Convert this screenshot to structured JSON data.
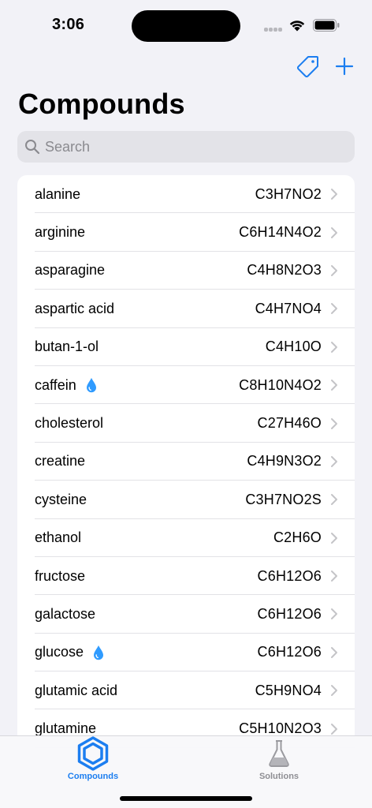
{
  "status": {
    "time": "3:06"
  },
  "nav": {
    "tag_icon": "tag-icon",
    "add_icon": "plus-icon"
  },
  "title": "Compounds",
  "search": {
    "placeholder": "Search",
    "value": ""
  },
  "compounds": [
    {
      "name": "alanine",
      "formula": "C3H7NO2",
      "liquid": false
    },
    {
      "name": "arginine",
      "formula": "C6H14N4O2",
      "liquid": false
    },
    {
      "name": "asparagine",
      "formula": "C4H8N2O3",
      "liquid": false
    },
    {
      "name": "aspartic acid",
      "formula": "C4H7NO4",
      "liquid": false
    },
    {
      "name": "butan-1-ol",
      "formula": "C4H10O",
      "liquid": false
    },
    {
      "name": "caffein",
      "formula": "C8H10N4O2",
      "liquid": true
    },
    {
      "name": "cholesterol",
      "formula": "C27H46O",
      "liquid": false
    },
    {
      "name": "creatine",
      "formula": "C4H9N3O2",
      "liquid": false
    },
    {
      "name": "cysteine",
      "formula": "C3H7NO2S",
      "liquid": false
    },
    {
      "name": "ethanol",
      "formula": "C2H6O",
      "liquid": false
    },
    {
      "name": "fructose",
      "formula": "C6H12O6",
      "liquid": false
    },
    {
      "name": "galactose",
      "formula": "C6H12O6",
      "liquid": false
    },
    {
      "name": "glucose",
      "formula": "C6H12O6",
      "liquid": true
    },
    {
      "name": "glutamic acid",
      "formula": "C5H9NO4",
      "liquid": false
    },
    {
      "name": "glutamine",
      "formula": "C5H10N2O3",
      "liquid": false
    }
  ],
  "tabs": [
    {
      "label": "Compounds",
      "icon": "hexagon-icon",
      "active": true
    },
    {
      "label": "Solutions",
      "icon": "flask-icon",
      "active": false
    }
  ],
  "colors": {
    "accent": "#1c7ef0",
    "inactive": "#8e8e93",
    "drop": "#2f9bff"
  }
}
